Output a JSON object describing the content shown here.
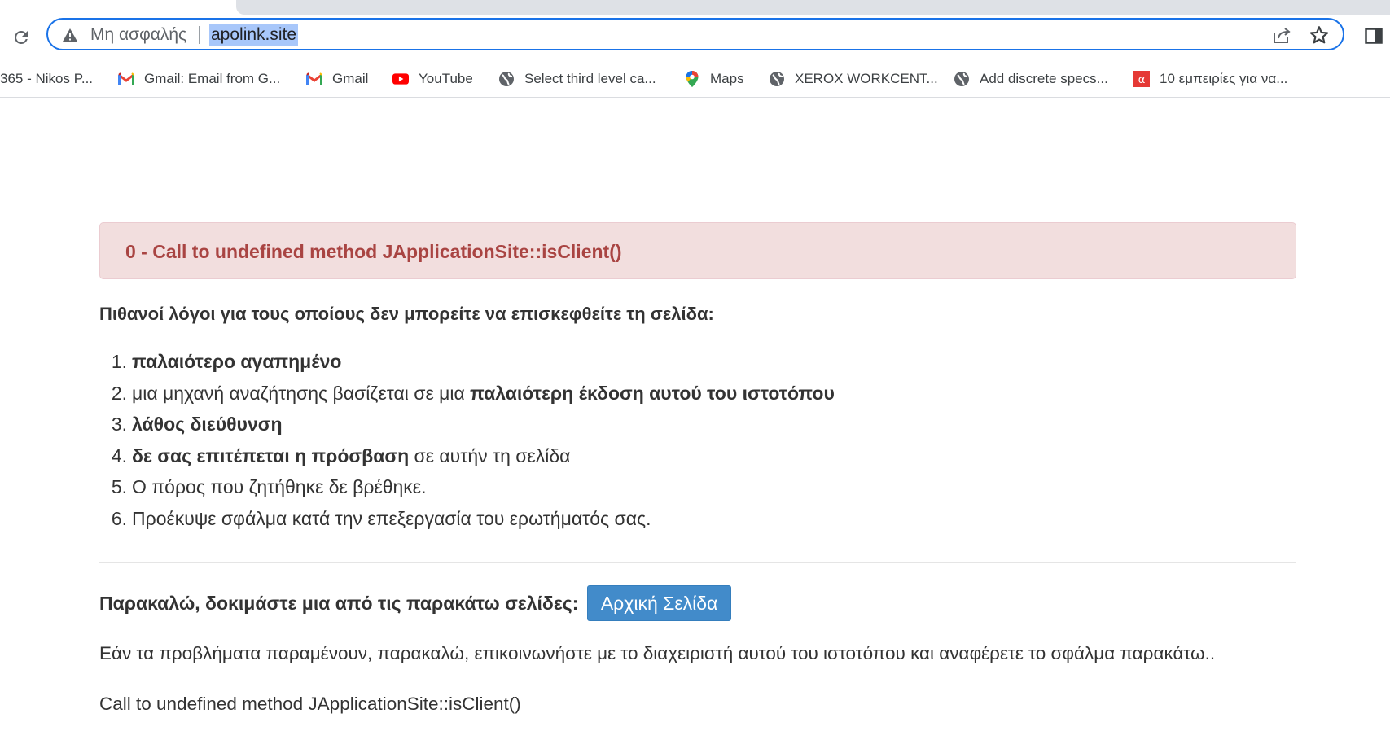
{
  "browser": {
    "security_label": "Μη ασφαλής",
    "url_host": "apolink.",
    "url_tld": "site",
    "bookmarks": [
      {
        "label": "365 - Nikos P...",
        "icon": "none"
      },
      {
        "label": "Gmail: Email from G...",
        "icon": "gmail-icon"
      },
      {
        "label": "Gmail",
        "icon": "gmail-icon"
      },
      {
        "label": "YouTube",
        "icon": "youtube-icon"
      },
      {
        "label": "Select third level ca...",
        "icon": "globe-icon"
      },
      {
        "label": "Maps",
        "icon": "maps-icon"
      },
      {
        "label": "XEROX WORKCENT...",
        "icon": "globe-icon"
      },
      {
        "label": "Add discrete specs...",
        "icon": "globe-icon"
      },
      {
        "label": "10 εμπειρίες για να...",
        "icon": "red-a-icon"
      }
    ],
    "accent_color": "#1a73e8"
  },
  "page": {
    "error_title": "0 - Call to undefined method JApplicationSite::isClient()",
    "reasons_heading": "Πιθανοί λόγοι για τους οποίους δεν μπορείτε να επισκεφθείτε τη σελίδα:",
    "reasons": [
      {
        "num": "1.",
        "pre": "",
        "bold": "παλαιότερο αγαπημένο",
        "post": ""
      },
      {
        "num": "2.",
        "pre": "μια μηχανή αναζήτησης βασίζεται σε μια ",
        "bold": "παλαιότερη έκδοση αυτού του ιστοτόπου",
        "post": ""
      },
      {
        "num": "3.",
        "pre": "",
        "bold": "λάθος διεύθυνση",
        "post": ""
      },
      {
        "num": "4.",
        "pre": "",
        "bold": "δε σας επιτέπεται η πρόσβαση",
        "post": " σε αυτήν τη σελίδα"
      },
      {
        "num": "5.",
        "pre": "Ο πόρος που ζητήθηκε δε βρέθηκε.",
        "bold": "",
        "post": ""
      },
      {
        "num": "6.",
        "pre": "Προέκυψε σφάλμα κατά την επεξεργασία του ερωτήματός σας.",
        "bold": "",
        "post": ""
      }
    ],
    "try_label": "Παρακαλώ, δοκιμάστε μια από τις παρακάτω σελίδες:",
    "home_button": "Αρχική Σελίδα",
    "contact_text": "Εάν τα προβλήματα παραμένουν, παρακαλώ, επικοινωνήστε με το διαχειριστή αυτού του ιστοτόπου και αναφέρετε το σφάλμα παρακάτω..",
    "error_detail": "Call to undefined method JApplicationSite::isClient()",
    "alert_bg_color": "#f2dede",
    "alert_text_color": "#a94442",
    "button_color": "#428bca"
  }
}
